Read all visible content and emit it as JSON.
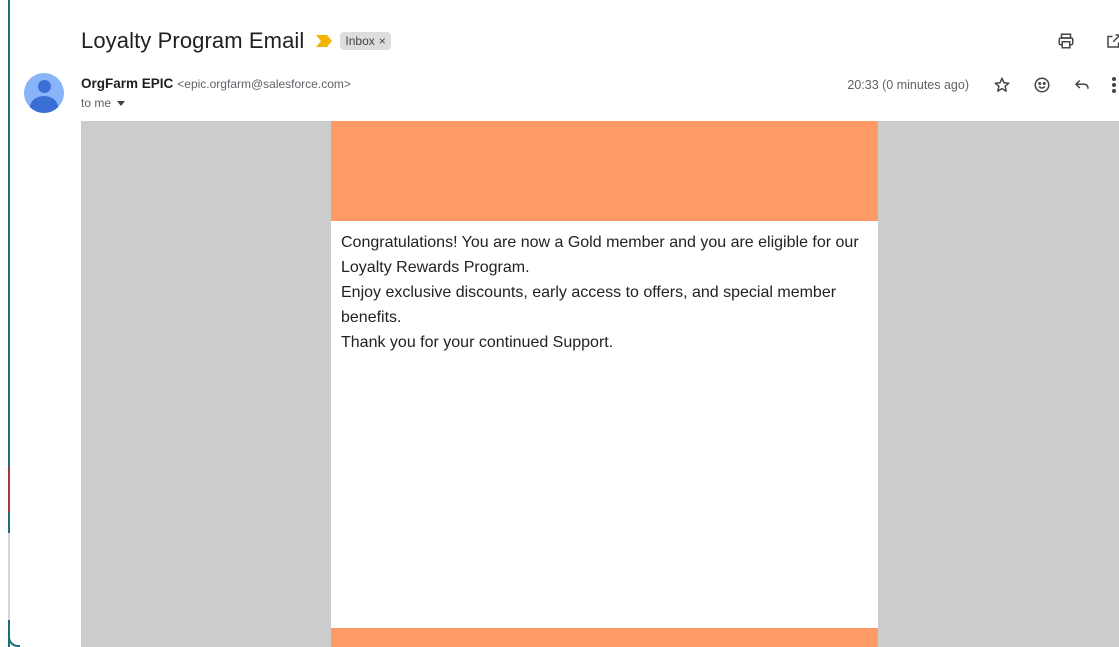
{
  "email": {
    "subject": "Loyalty Program Email",
    "label": "Inbox",
    "label_remove": "×",
    "sender_name": "OrgFarm EPIC",
    "sender_email": "<epic.orgfarm@salesforce.com>",
    "recipient": "to me",
    "timestamp": "20:33 (0 minutes ago)"
  },
  "body": {
    "line1": "Congratulations! You are now a Gold member and you are eligible for our Loyalty Rewards Program.",
    "line2": "Enjoy exclusive discounts, early access to offers, and special member benefits.",
    "line3": "Thank you for your continued Support."
  },
  "colors": {
    "banner": "#ff9966",
    "canvas": "#cccccc",
    "importance": "#f4b400",
    "avatar_bg": "#8ab4f8",
    "avatar_fg": "#3b6fd6"
  },
  "icons": {
    "print": "print-icon",
    "open_new": "open-in-new-window-icon",
    "star": "star-icon",
    "emoji": "emoji-reaction-icon",
    "reply": "reply-icon",
    "more": "more-vertical-icon",
    "importance": "importance-marker-icon",
    "avatar": "default-avatar-icon"
  }
}
